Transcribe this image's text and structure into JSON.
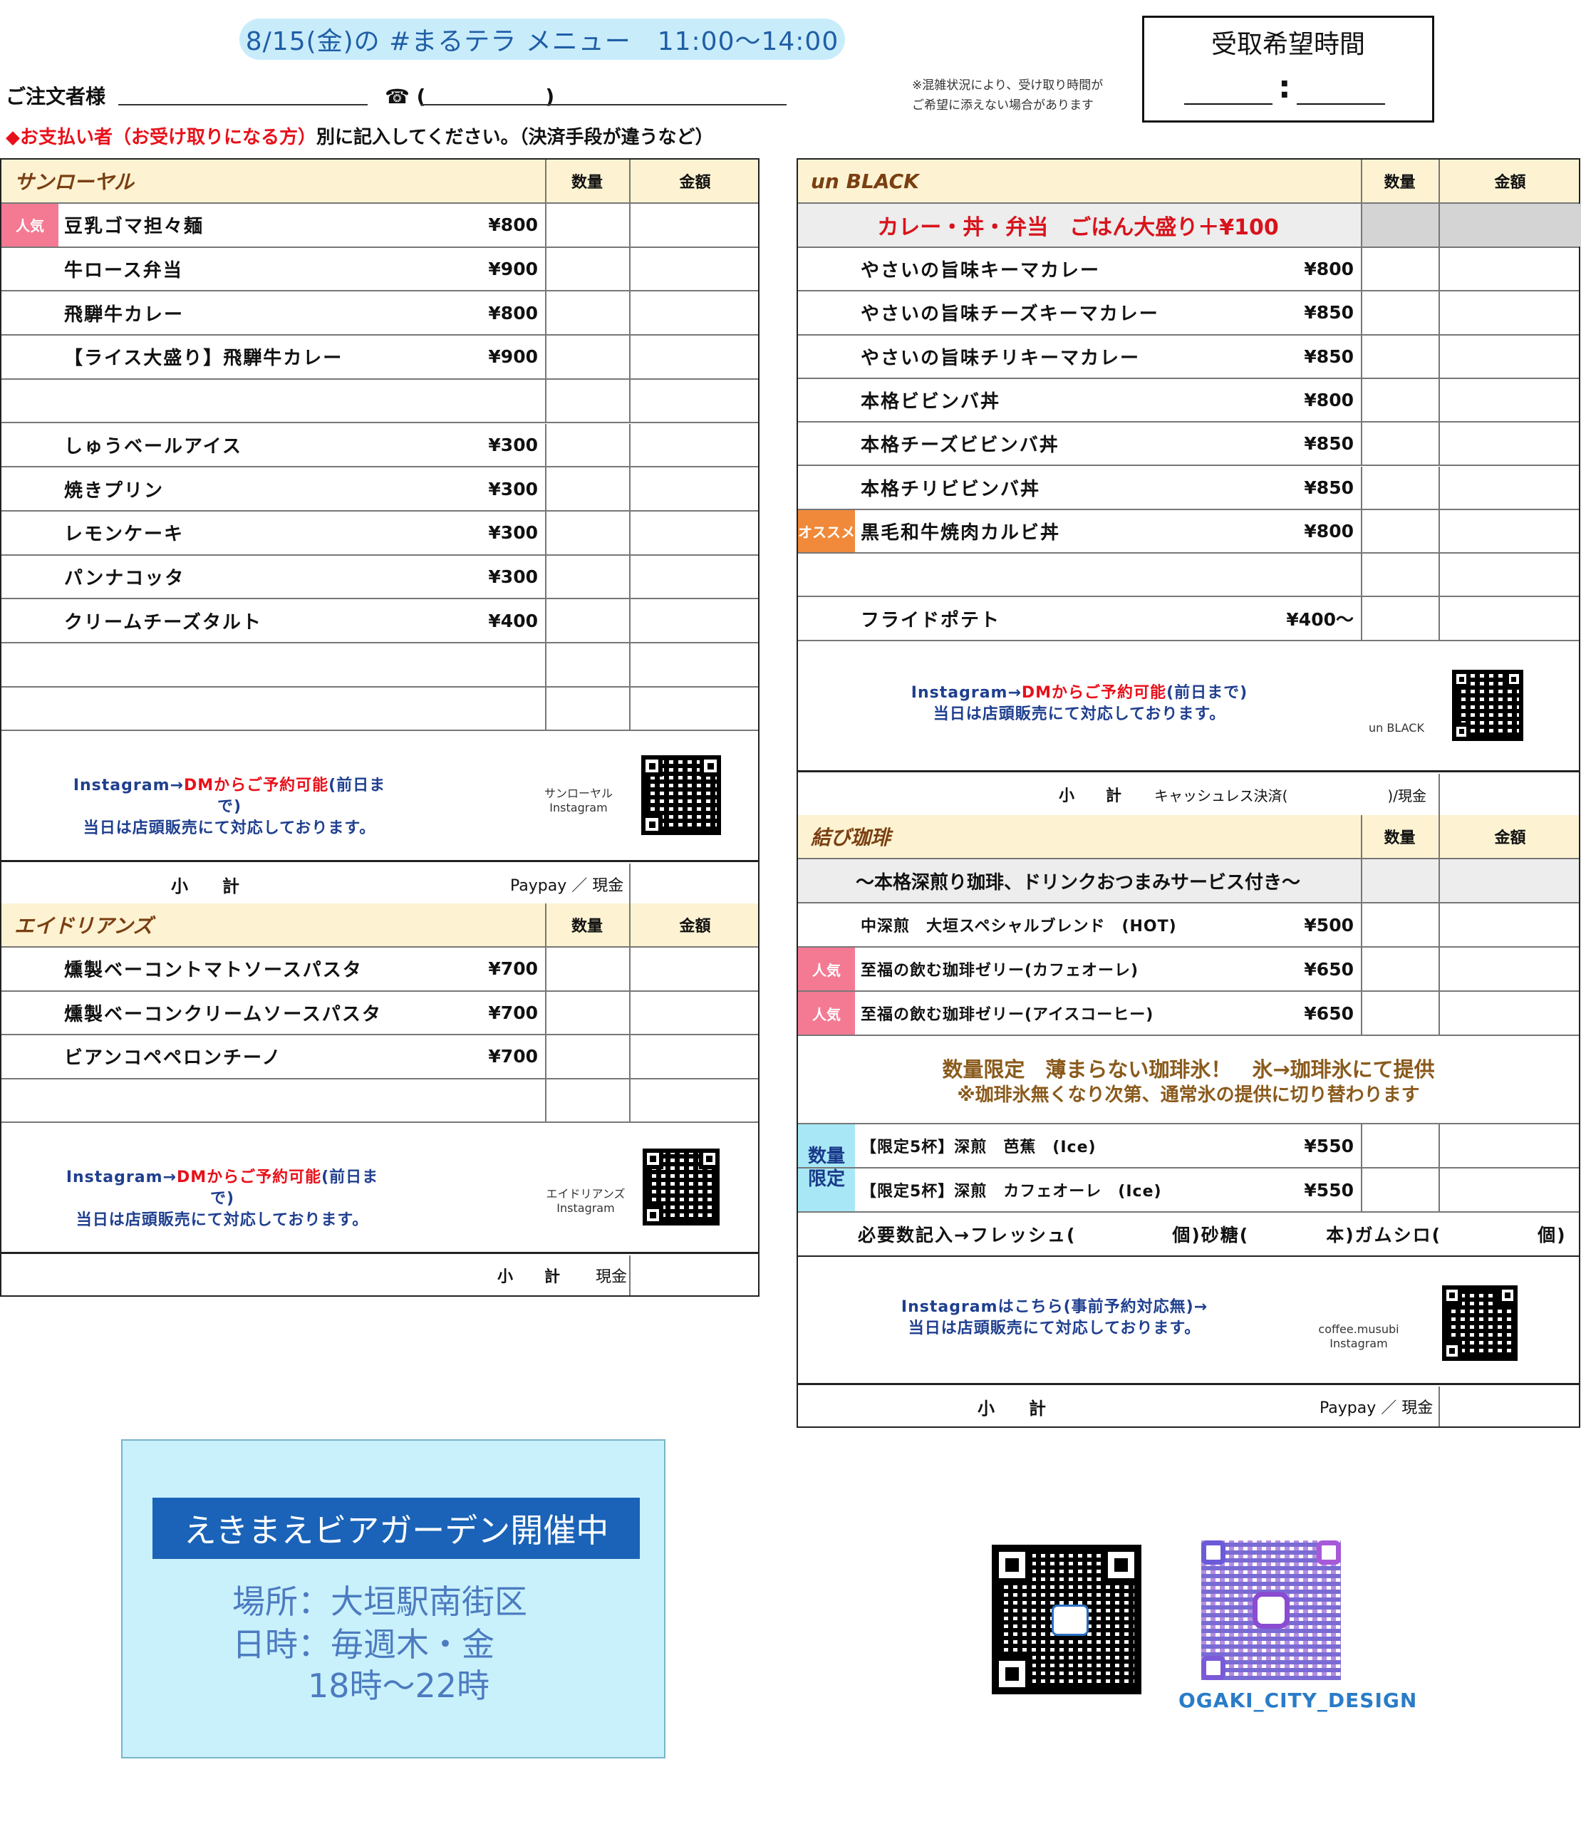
{
  "title": "8/15(金)の #まるテラ メニュー　11:00～14:00",
  "pickup": {
    "label": "受取希望時間",
    "colon": ":"
  },
  "note": [
    "※混雑状況により、受け取り時間が",
    "ご希望に添えない場合があります"
  ],
  "orderer_label": "ご注文者様",
  "tel_label": "☎ (　　　　　　)",
  "payment_red": "◆お支払い者（お受け取りになる方）",
  "payment_rest": "別に記入してください。（決済手段が違うなど）",
  "common": {
    "qty": "数量",
    "amount": "金額",
    "subtotal_label": "小　　計",
    "instagram_line1_a": "Instagram→",
    "instagram_line1_b": "DMからご予約可能",
    "instagram_line1_c": "(前日まで)",
    "instagram_line2": "当日は店頭販売にて対応しております。"
  },
  "sanroyal": {
    "name": "サンローヤル",
    "items": [
      {
        "tag": "人気",
        "name": "豆乳ゴマ担々麺",
        "price": "¥800"
      },
      {
        "name": "牛ロース弁当",
        "price": "¥900"
      },
      {
        "name": "飛騨牛カレー",
        "price": "¥800"
      },
      {
        "name": "【ライス大盛り】飛騨牛カレー",
        "price": "¥900"
      },
      {
        "name": "",
        "price": ""
      },
      {
        "name": "しゅうベールアイス",
        "price": "¥300"
      },
      {
        "name": "焼きプリン",
        "price": "¥300"
      },
      {
        "name": "レモンケーキ",
        "price": "¥300"
      },
      {
        "name": "パンナコッタ",
        "price": "¥300"
      },
      {
        "name": "クリームチーズタルト",
        "price": "¥400"
      },
      {
        "name": "",
        "price": ""
      },
      {
        "name": "",
        "price": ""
      }
    ],
    "qr_caption": [
      "サンローヤル",
      "Instagram"
    ],
    "payment": "Paypay ／ 現金"
  },
  "adriance": {
    "name": "エイドリアンズ",
    "items": [
      {
        "name": "燻製ベーコントマトソースパスタ",
        "price": "¥700"
      },
      {
        "name": "燻製ベーコンクリームソースパスタ",
        "price": "¥700"
      },
      {
        "name": "ビアンコペペロンチーノ",
        "price": "¥700"
      },
      {
        "name": "",
        "price": ""
      }
    ],
    "qr_caption": [
      "エイドリアンズ",
      "Instagram"
    ],
    "subtotal_label": "小　　計",
    "payment": "現金"
  },
  "unblack": {
    "name": "un BLACK",
    "banner": "カレー・丼・弁当　ごはん大盛り＋¥100",
    "items": [
      {
        "name": "やさいの旨味キーマカレー",
        "price": "¥800"
      },
      {
        "name": "やさいの旨味チーズキーマカレー",
        "price": "¥850"
      },
      {
        "name": "やさいの旨味チリキーマカレー",
        "price": "¥850"
      },
      {
        "name": "本格ビビンバ丼",
        "price": "¥800"
      },
      {
        "name": "本格チーズビビンバ丼",
        "price": "¥850"
      },
      {
        "name": "本格チリビビンバ丼",
        "price": "¥850"
      },
      {
        "tag": "オススメ",
        "name": "黒毛和牛焼肉カルビ丼",
        "price": "¥800"
      },
      {
        "name": "",
        "price": ""
      },
      {
        "name": "フライドポテト",
        "price": "¥400～"
      }
    ],
    "qr_caption": [
      "un BLACK"
    ],
    "subtotal_label": "小　　計",
    "payment": "キャッシュレス決済(　　　　　　　)/現金"
  },
  "musubi": {
    "name": "結び珈琲",
    "banner": "～本格深煎り珈琲、ドリンクおつまみサービス付き～",
    "items": [
      {
        "name": "中深煎　大垣スペシャルブレンド　(HOT)",
        "price": "¥500"
      },
      {
        "tag": "人気",
        "name": "至福の飲む珈琲ゼリー(カフェオーレ)",
        "price": "¥650"
      },
      {
        "tag": "人気",
        "name": "至福の飲む珈琲ゼリー(アイスコーヒー)",
        "price": "¥650"
      }
    ],
    "limited_line1": "数量限定　薄まらない珈琲氷！　氷→珈琲氷にて提供",
    "limited_line2": "※珈琲氷無くなり次第、通常氷の提供に切り替わります",
    "limited_tag": "数量限定",
    "limited_items": [
      {
        "name": "【限定5杯】深煎　芭蕉　(Ice)",
        "price": "¥550"
      },
      {
        "name": "【限定5杯】深煎　カフェオーレ　(Ice)",
        "price": "¥550"
      }
    ],
    "extras": "必要数記入→フレッシュ(　　　　　個)砂糖(　　　　本)ガムシロ(　　　　　個)",
    "instagram_line1": "Instagramはこちら(事前予約対応無)→",
    "qr_caption": [
      "coffee.musubi",
      "Instagram"
    ],
    "subtotal_label": "小　　計",
    "payment": "Paypay ／ 現金"
  },
  "beer": {
    "banner": "えきまえビアガーデン開催中",
    "place": "場所：大垣駅南街区",
    "date": "日時：毎週木・金",
    "time": "18時～22時"
  },
  "ogaki": "OGAKI_CITY_DESIGN"
}
